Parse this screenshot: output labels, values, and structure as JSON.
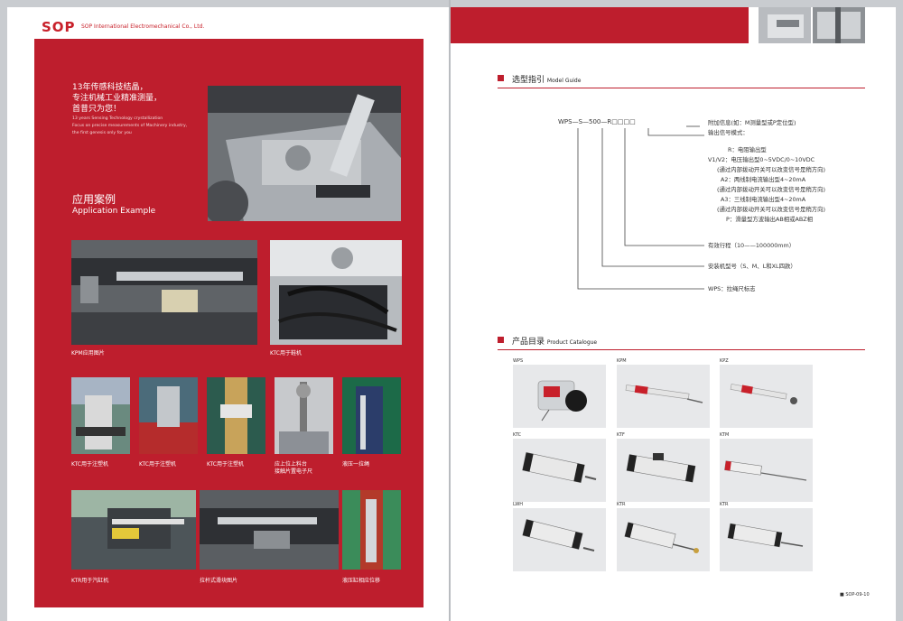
{
  "left_page": {
    "logo": "SOP",
    "company": "SOP International Electromechanical Co., Ltd.",
    "slogan_cn": [
      "13年传感科技结晶，",
      "专注机械工业精准测量，",
      "首昔只为您！"
    ],
    "slogan_en": [
      "13 years Sensing Technology crystallization",
      "Focus on precise measurements of Machinery industry,",
      "the first genesis only for you"
    ],
    "section_cn": "应用案例",
    "section_en": "Application Example",
    "captions": {
      "kpm": "KPM应用图片",
      "ktc_shoe": "KTC用于鞋机",
      "ktc_a": "KTC用于注塑机",
      "ktc_b": "KTC用于注塑机",
      "ktc_c": "KTC用于注塑机",
      "motor_line": [
        "应上位上料台",
        "接触片置电子尺"
      ],
      "mold": "液压一拉绳",
      "ktr_cylinder": "KTR用于汽缸机",
      "pull_type": "拉杆式滑块图片",
      "hydraulic": "液压缸相应位移"
    }
  },
  "right_page": {
    "model_guide": {
      "title_cn": "选型指引",
      "title_en": "Model Guide",
      "code": "WPS—S—500—R□□□□",
      "lines": [
        "附加信息(如：M测量型或P定位型)",
        "输出信号模式：",
        "R：电阻输出型",
        "V1/V2：电压输出型0~5VDC/0~10VDC",
        "(通过内部拨动开关可以改变信号是稍方向)",
        "A2：两线制电流输出型4~20mA",
        "(通过内部拨动开关可以改变信号是稍方向)",
        "A3：三线制电流输出型4~20mA",
        "(通过内部拨动开关可以改变信号是稍方向)",
        "P：滑量型方波输出AB相或ABZ相"
      ],
      "stroke": "有效行程（10——100000mm）",
      "install": "安装机型号（S、M、L和XL四款）",
      "brand": "WPS：拉绳尺标志"
    },
    "catalogue": {
      "title_cn": "产品目录",
      "title_en": "Product Catalogue",
      "items": [
        "WPS",
        "KPM",
        "KPZ",
        "KTC",
        "KTF",
        "KTM",
        "LWH",
        "KTR",
        "KTR"
      ]
    },
    "page_number": "■ SOP-09-10"
  },
  "colors": {
    "brand_red": "#be1e2d"
  }
}
